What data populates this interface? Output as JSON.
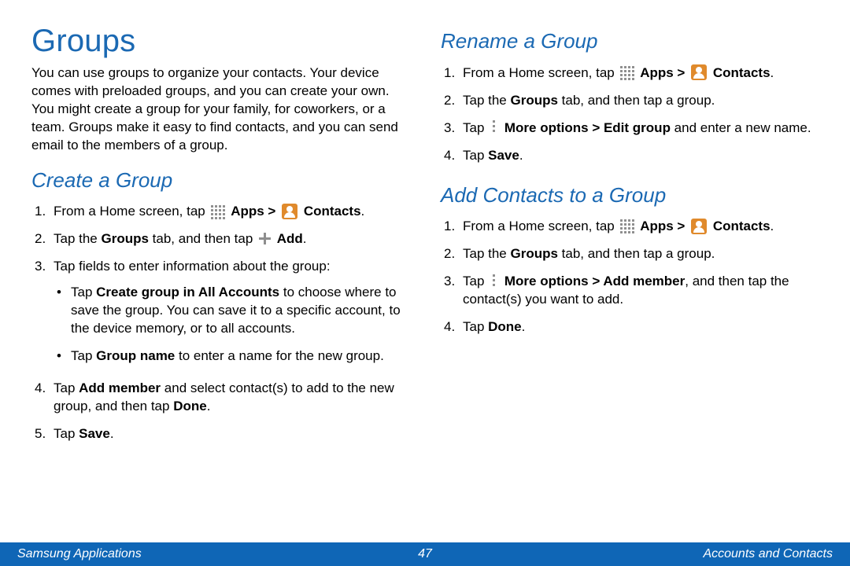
{
  "left": {
    "title": "Groups",
    "intro": "You can use groups to organize your contacts. Your device comes with preloaded groups, and you can create your own. You might create a group for your family, for coworkers, or a team. Groups make it easy to find contacts, and you can send email to the members of a group.",
    "h2": "Create a Group",
    "s1a": "From a Home screen, tap ",
    "s1b": "Apps > ",
    "s1c": "Contacts",
    "s2a": "Tap the ",
    "s2b": "Groups",
    "s2c": " tab, and then tap ",
    "s2d": "Add",
    "s3": "Tap fields to enter information about the group:",
    "b1a": "Tap ",
    "b1b": "Create group in All Accounts",
    "b1c": " to choose where to save the group. You can save it to a specific account, to the device memory, or to all accounts.",
    "b2a": "Tap ",
    "b2b": "Group name",
    "b2c": " to enter a name for the new group.",
    "s4a": "Tap ",
    "s4b": "Add member",
    "s4c": " and select contact(s) to add to the new group, and then tap ",
    "s4d": "Done",
    "s5a": "Tap ",
    "s5b": "Save"
  },
  "right": {
    "h2a": "Rename a Group",
    "r1a": "From a Home screen, tap ",
    "r1b": "Apps > ",
    "r1c": "Contacts",
    "r2a": "Tap the ",
    "r2b": "Groups",
    "r2c": " tab, and then tap a group.",
    "r3a": "Tap ",
    "r3b": "More options > Edit group",
    "r3c": " and enter a new name.",
    "r4a": "Tap ",
    "r4b": "Save",
    "h2b": "Add Contacts to a Group",
    "a1a": "From a Home screen, tap ",
    "a1b": "Apps > ",
    "a1c": "Contacts",
    "a2a": "Tap the ",
    "a2b": "Groups",
    "a2c": " tab, and then tap a group.",
    "a3a": "Tap ",
    "a3b": "More options > Add member",
    "a3c": ", and then tap the contact(s) you want to add.",
    "a4a": "Tap ",
    "a4b": "Done"
  },
  "footer": {
    "left": "Samsung Applications",
    "page": "47",
    "right": "Accounts and Contacts"
  }
}
